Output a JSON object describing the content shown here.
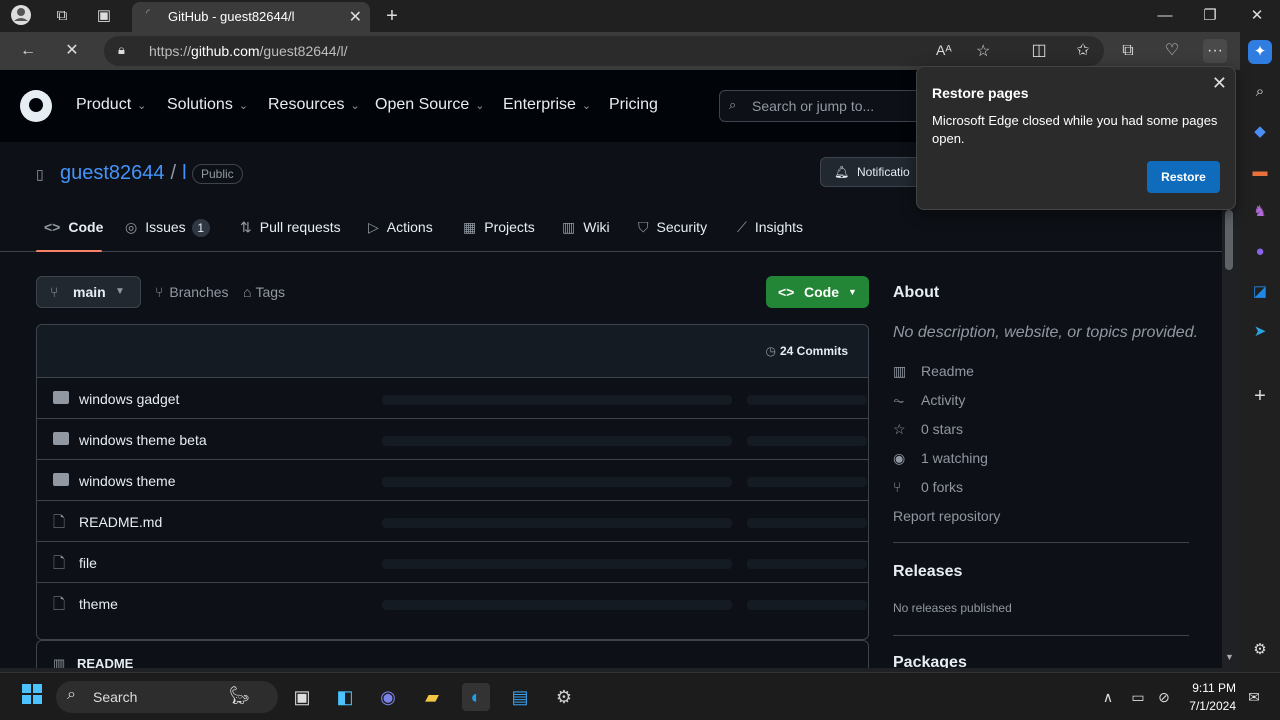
{
  "browser": {
    "tab_title": "GitHub - guest82644/l",
    "url_prefix": "https://",
    "url_host": "github.com",
    "url_path": "/guest82644/l/"
  },
  "github": {
    "nav": {
      "product": "Product",
      "solutions": "Solutions",
      "resources": "Resources",
      "open_source": "Open Source",
      "enterprise": "Enterprise",
      "pricing": "Pricing"
    },
    "search_placeholder": "Search or jump to...",
    "repo": {
      "owner": "guest82644",
      "separator": "/",
      "name": "l",
      "visibility": "Public",
      "notifications": "Notificatio"
    },
    "tabs": {
      "code": "Code",
      "issues": "Issues",
      "issues_count": "1",
      "pull_requests": "Pull requests",
      "actions": "Actions",
      "projects": "Projects",
      "wiki": "Wiki",
      "security": "Security",
      "insights": "Insights"
    },
    "branch": "main",
    "branches": "Branches",
    "tags": "Tags",
    "code_button": "Code",
    "commits": "24 Commits",
    "files": [
      {
        "name": "windows gadget",
        "type": "folder"
      },
      {
        "name": "windows theme beta",
        "type": "folder"
      },
      {
        "name": "windows theme",
        "type": "folder"
      },
      {
        "name": "README.md",
        "type": "file"
      },
      {
        "name": "file",
        "type": "file"
      },
      {
        "name": "theme",
        "type": "file"
      }
    ],
    "readme_label": "README",
    "about": {
      "heading": "About",
      "description": "No description, website, or topics provided.",
      "readme": "Readme",
      "activity": "Activity",
      "stars": "0 stars",
      "watching": "1 watching",
      "forks": "0 forks",
      "report": "Report repository",
      "releases_heading": "Releases",
      "releases_text": "No releases published",
      "packages_heading": "Packages"
    }
  },
  "popup": {
    "title": "Restore pages",
    "body": "Microsoft Edge closed while you had some pages open.",
    "button": "Restore"
  },
  "taskbar": {
    "search": "Search",
    "time": "9:11 PM",
    "date": "7/1/2024"
  },
  "colors": {
    "accent_link": "#4493f8",
    "code_button": "#238636",
    "tab_underline": "#f78166",
    "restore_button": "#0f6cbd"
  }
}
